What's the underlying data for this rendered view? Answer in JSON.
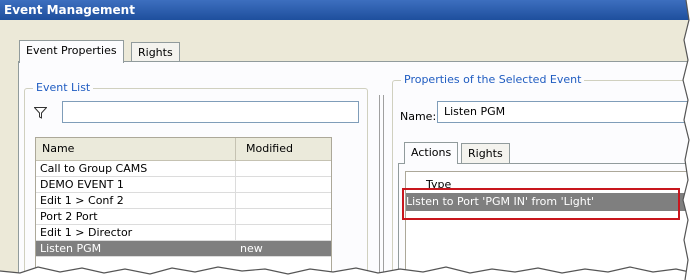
{
  "window": {
    "title": "Event Management"
  },
  "outer_tabs": {
    "event_properties": "Event Properties",
    "rights": "Rights"
  },
  "event_list": {
    "group_title": "Event List",
    "filter_value": "",
    "filter_icon": "funnel-icon",
    "columns": {
      "name": "Name",
      "modified": "Modified"
    },
    "rows": [
      {
        "name": "Call to Group CAMS",
        "modified": ""
      },
      {
        "name": "DEMO EVENT 1",
        "modified": ""
      },
      {
        "name": "Edit 1 > Conf 2",
        "modified": ""
      },
      {
        "name": "Port 2 Port",
        "modified": ""
      },
      {
        "name": "Edit 1 > Director",
        "modified": ""
      },
      {
        "name": "Listen PGM",
        "modified": "new"
      }
    ],
    "selected_index": 5
  },
  "properties": {
    "group_title": "Properties of the Selected Event",
    "name_label": "Name:",
    "name_value": "Listen PGM",
    "inner_tabs": {
      "actions": "Actions",
      "rights": "Rights"
    },
    "actions_column": "Type",
    "actions": [
      "Listen to Port 'PGM IN' from 'Light'"
    ]
  },
  "colors": {
    "title_bar": "#1e4f9d",
    "group_title": "#1f5cc1",
    "selection": "#7f7f7f",
    "highlight_box": "#c8161d"
  }
}
